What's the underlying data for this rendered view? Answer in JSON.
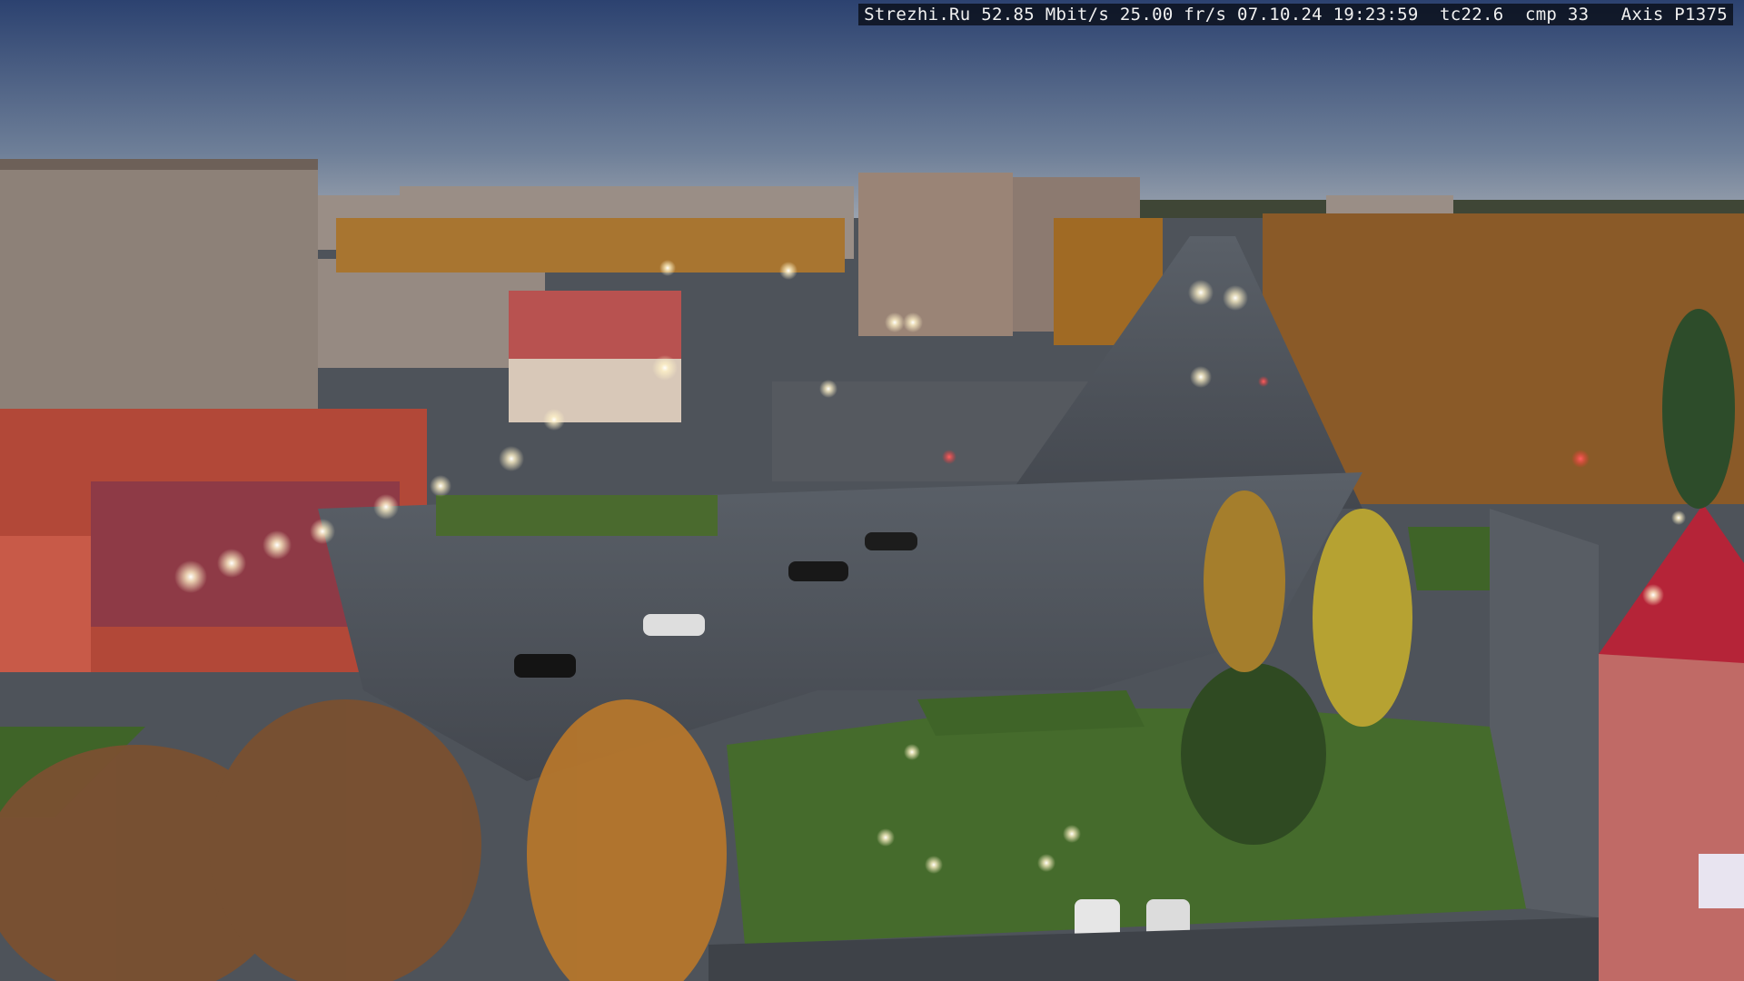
{
  "overlay": {
    "text": "Strezhi.Ru 52.85 Mbit/s 25.00 fr/s 07.10.24 19:23:59  tc22.6  cmp 33   Axis P1375"
  },
  "scene": {
    "sky_top": "#2f4470",
    "sky_horizon": "#8c98a8",
    "asphalt": "#4b5058",
    "grass": "#4a6e2e",
    "foliage_gold": "#c88a2a",
    "building_red": "#b2403a",
    "building_panel": "#8f8178",
    "lamp_glow": "#fff2c8"
  }
}
